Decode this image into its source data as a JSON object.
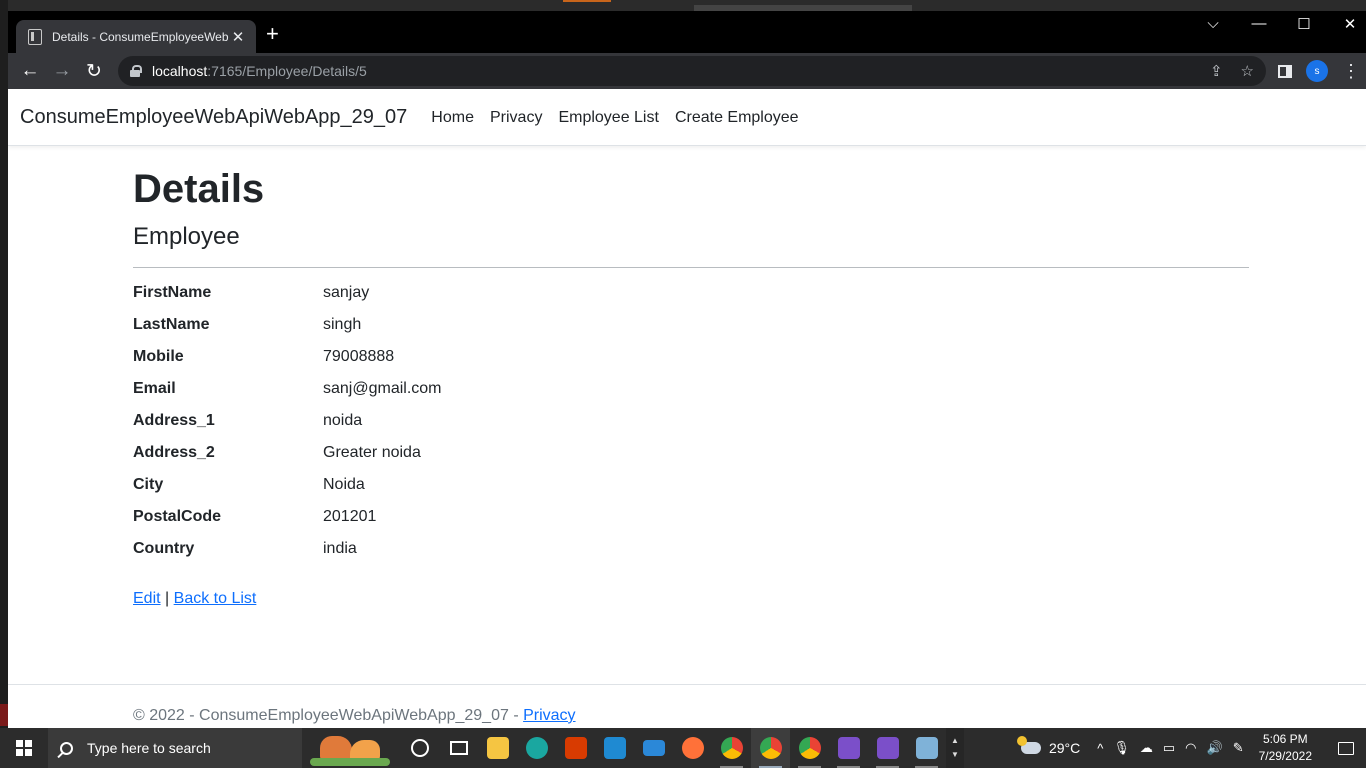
{
  "browser": {
    "tab_title": "Details - ConsumeEmployeeWeb",
    "tab_close": "✕",
    "new_tab": "+",
    "url_host": "localhost",
    "url_path": ":7165/Employee/Details/5",
    "profile_initial": "s",
    "window_controls": {
      "dropdown": "⌵",
      "minimize": "—",
      "maximize": "☐",
      "close": "✕"
    }
  },
  "app": {
    "brand": "ConsumeEmployeeWebApiWebApp_29_07",
    "nav": [
      "Home",
      "Privacy",
      "Employee List",
      "Create Employee"
    ]
  },
  "main": {
    "title": "Details",
    "subtitle": "Employee",
    "fields": [
      {
        "label": "FirstName",
        "value": "sanjay"
      },
      {
        "label": "LastName",
        "value": "singh"
      },
      {
        "label": "Mobile",
        "value": "79008888"
      },
      {
        "label": "Email",
        "value": "sanj@gmail.com"
      },
      {
        "label": "Address_1",
        "value": "noida"
      },
      {
        "label": "Address_2",
        "value": "Greater noida"
      },
      {
        "label": "City",
        "value": "Noida"
      },
      {
        "label": "PostalCode",
        "value": "201201"
      },
      {
        "label": "Country",
        "value": "india"
      }
    ],
    "edit_link": "Edit",
    "separator": "|",
    "back_link": "Back to List"
  },
  "footer": {
    "text": "© 2022 - ConsumeEmployeeWebApiWebApp_29_07 - ",
    "privacy_link": "Privacy"
  },
  "taskbar": {
    "search_placeholder": "Type here to search",
    "temperature": "29°C",
    "time": "5:06 PM",
    "date": "7/29/2022",
    "icon_colors": {
      "explorer": "#f5c542",
      "edge": "#1aa7a0",
      "office": "#d83b01",
      "vscode": "#1f8ad2",
      "mail": "#2b88d8",
      "firefox": "#ff7139",
      "chrome": "#34a853",
      "visual_studio": "#7b4fc9",
      "notepad": "#7fb2d8"
    }
  }
}
